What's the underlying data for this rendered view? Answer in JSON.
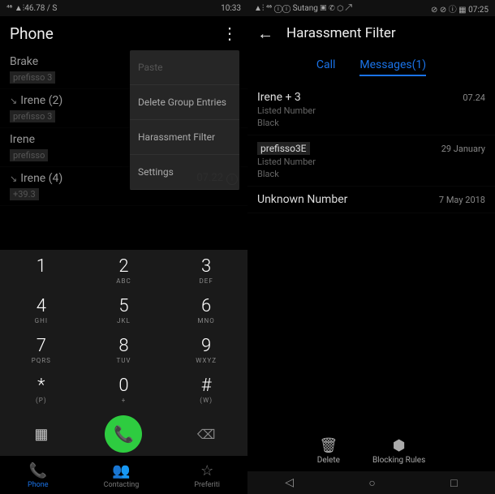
{
  "left": {
    "status": {
      "left": "⁴⁶ ▲⫶46.78 / S",
      "time": "10:33"
    },
    "title": "Phone",
    "calls": [
      {
        "name": "Brake",
        "sub": "prefisso 3"
      },
      {
        "name": "Irene (2)",
        "sub": "prefisso 3",
        "icon": "↘"
      },
      {
        "name": "Irene",
        "sub": "prefisso"
      },
      {
        "name": "Irene (4)",
        "sub": "+39.3",
        "icon": "↘",
        "time": "07.22"
      }
    ],
    "menu": {
      "paste": "Paste",
      "delete": "Delete Group Entries",
      "harassment": "Harassment Filter",
      "settings": "Settings"
    },
    "keys": [
      {
        "n": "1",
        "s": ""
      },
      {
        "n": "2",
        "s": "ABC"
      },
      {
        "n": "3",
        "s": "DEF"
      },
      {
        "n": "4",
        "s": "GHI"
      },
      {
        "n": "5",
        "s": "JKL"
      },
      {
        "n": "6",
        "s": "MNO"
      },
      {
        "n": "7",
        "s": "PQRS"
      },
      {
        "n": "8",
        "s": "TUV"
      },
      {
        "n": "9",
        "s": "WXYZ"
      },
      {
        "n": "*",
        "s": "(P)"
      },
      {
        "n": "0",
        "s": "+"
      },
      {
        "n": "#",
        "s": "(W)"
      }
    ],
    "tabs": {
      "phone": "Phone",
      "contacting": "Contacting",
      "preferred": "Preferiti"
    }
  },
  "right": {
    "status": {
      "left": "▲⫶ ⁴⁶ ⓘⓘ Sutang ▣ ✆ ⬡ ↗",
      "right": "⊘ ⊘ ⓘ ▦ 07:25"
    },
    "title": "Harassment Filter",
    "tabs": {
      "call": "Call",
      "messages": "Messages(1)"
    },
    "items": [
      {
        "name": "Irene + 3",
        "time": "07.24",
        "sub1": "Listed Number",
        "sub2": "Black"
      },
      {
        "name": "prefisso3E",
        "time": "29 January",
        "sub1": "Listed Number",
        "sub2": "Black"
      },
      {
        "name": "Unknown Number",
        "time": "7 May 2018"
      }
    ],
    "actions": {
      "delete": "Delete",
      "rules": "Blocking Rules"
    }
  }
}
